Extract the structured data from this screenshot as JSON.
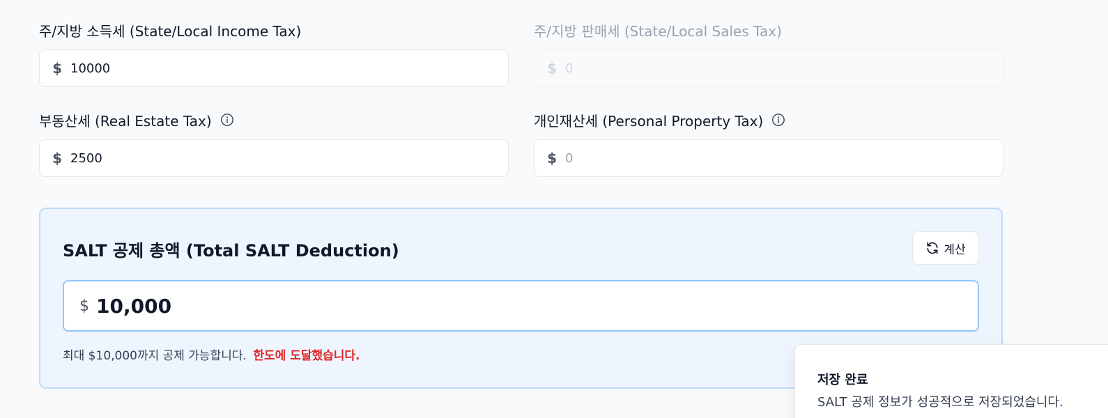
{
  "fields": {
    "income_tax": {
      "label": "주/지방 소득세 (State/Local Income Tax)",
      "currency": "$",
      "value": "10000",
      "placeholder": "0"
    },
    "sales_tax": {
      "label": "주/지방 판매세 (State/Local Sales Tax)",
      "currency": "$",
      "value": "",
      "placeholder": "0",
      "disabled": true
    },
    "real_estate_tax": {
      "label": "부동산세 (Real Estate Tax)",
      "currency": "$",
      "value": "2500",
      "placeholder": "0"
    },
    "personal_property_tax": {
      "label": "개인재산세 (Personal Property Tax)",
      "currency": "$",
      "value": "",
      "placeholder": "0"
    }
  },
  "summary": {
    "title": "SALT 공제 총액 (Total SALT Deduction)",
    "calc_button": "계산",
    "currency": "$",
    "total": "10,000",
    "note": "최대 $10,000까지 공제 가능합니다.",
    "limit_warning": "한도에 도달했습니다."
  },
  "toast": {
    "title": "저장 완료",
    "message": "SALT 공제 정보가 성공적으로 저장되었습니다."
  },
  "colors": {
    "accent_border": "#93c5fd",
    "summary_bg": "#eef5fe",
    "warning": "#dc2626"
  },
  "icons": {
    "info": "info-icon",
    "refresh": "refresh-icon"
  }
}
